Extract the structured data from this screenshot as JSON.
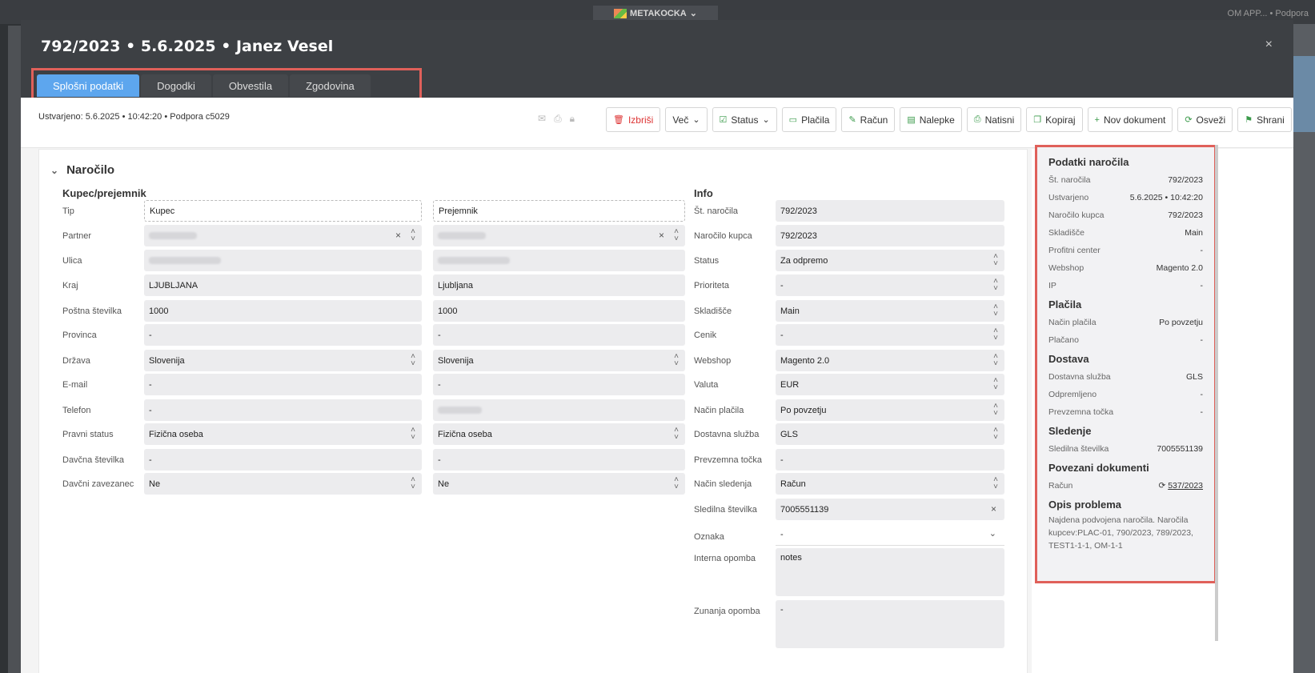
{
  "background": {
    "app_logo": "METAKOCKA",
    "top_right": "OM APP... • Podpora"
  },
  "modal": {
    "title": "792/2023 • 5.6.2025 • Janez Vesel",
    "close": "×",
    "tabs": [
      "Splošni podatki",
      "Dogodki",
      "Obvestila",
      "Zgodovina"
    ],
    "active_tab": "Splošni podatki"
  },
  "toolbar": {
    "created": "Ustvarjeno: 5.6.2025 • 10:42:20 • Podpora c5029",
    "buttons": {
      "delete": "Izbriši",
      "more": "Več",
      "status": "Status",
      "payments": "Plačila",
      "invoice": "Račun",
      "labels": "Nalepke",
      "print": "Natisni",
      "copy": "Kopiraj",
      "new_doc": "Nov dokument",
      "refresh": "Osveži",
      "save": "Shrani"
    }
  },
  "order": {
    "section_title": "Naročilo",
    "buyer_heading": "Kupec/prejemnik",
    "info_heading": "Info",
    "buyer_labels": {
      "tip": "Tip",
      "partner": "Partner",
      "ulica": "Ulica",
      "kraj": "Kraj",
      "posta": "Poštna številka",
      "provinca": "Provinca",
      "drzava": "Država",
      "email": "E-mail",
      "telefon": "Telefon",
      "pravni": "Pravni status",
      "davcna": "Davčna številka",
      "zavezanec": "Davčni zavezanec"
    },
    "kupec": {
      "tip": "Kupec",
      "kraj": "LJUBLJANA",
      "posta": "1000",
      "provinca": "-",
      "drzava": "Slovenija",
      "email": "-",
      "telefon": "-",
      "pravni": "Fizična oseba",
      "davcna": "-",
      "zavezanec": "Ne"
    },
    "prejemnik": {
      "tip": "Prejemnik",
      "kraj": "Ljubljana",
      "posta": "1000",
      "provinca": "-",
      "drzava": "Slovenija",
      "email": "-",
      "pravni": "Fizična oseba",
      "davcna": "-",
      "zavezanec": "Ne"
    },
    "info_labels": {
      "st": "Št. naročila",
      "kupca": "Naročilo kupca",
      "status": "Status",
      "prioriteta": "Prioriteta",
      "skladisce": "Skladišče",
      "cenik": "Cenik",
      "webshop": "Webshop",
      "valuta": "Valuta",
      "placilo": "Način plačila",
      "dostava": "Dostavna služba",
      "prevzem": "Prevzemna točka",
      "sledenje": "Način sledenja",
      "sledilna": "Sledilna številka",
      "oznaka": "Oznaka",
      "interna": "Interna opomba",
      "zunanja": "Zunanja opomba"
    },
    "info": {
      "st": "792/2023",
      "kupca": "792/2023",
      "status": "Za odpremo",
      "prioriteta": "-",
      "skladisce": "Main",
      "cenik": "-",
      "webshop": "Magento 2.0",
      "valuta": "EUR",
      "placilo": "Po povzetju",
      "dostava": "GLS",
      "prevzem": "-",
      "sledenje": "Račun",
      "sledilna": "7005551139",
      "oznaka": "-",
      "interna": "notes",
      "zunanja": "-"
    }
  },
  "summary": {
    "h_order": "Podatki naročila",
    "order_rows": [
      {
        "label": "Št. naročila",
        "value": "792/2023"
      },
      {
        "label": "Ustvarjeno",
        "value": "5.6.2025 • 10:42:20"
      },
      {
        "label": "Naročilo kupca",
        "value": "792/2023"
      },
      {
        "label": "Skladišče",
        "value": "Main"
      },
      {
        "label": "Profitni center",
        "value": "-"
      },
      {
        "label": "Webshop",
        "value": "Magento 2.0"
      },
      {
        "label": "IP",
        "value": "-"
      }
    ],
    "h_payments": "Plačila",
    "payment_rows": [
      {
        "label": "Način plačila",
        "value": "Po povzetju"
      },
      {
        "label": "Plačano",
        "value": "-"
      }
    ],
    "h_delivery": "Dostava",
    "delivery_rows": [
      {
        "label": "Dostavna služba",
        "value": "GLS"
      },
      {
        "label": "Odpremljeno",
        "value": "-"
      },
      {
        "label": "Prevzemna točka",
        "value": "-"
      }
    ],
    "h_tracking": "Sledenje",
    "tracking_rows": [
      {
        "label": "Sledilna številka",
        "value": "7005551139"
      }
    ],
    "h_related": "Povezani dokumenti",
    "related_label": "Račun",
    "related_link": "537/2023",
    "h_problem": "Opis problema",
    "problem_text": "Najdena podvojena naročila. Naročila kupcev:PLAC-01, 790/2023, 789/2023, TEST1-1-1, OM-1-1"
  }
}
